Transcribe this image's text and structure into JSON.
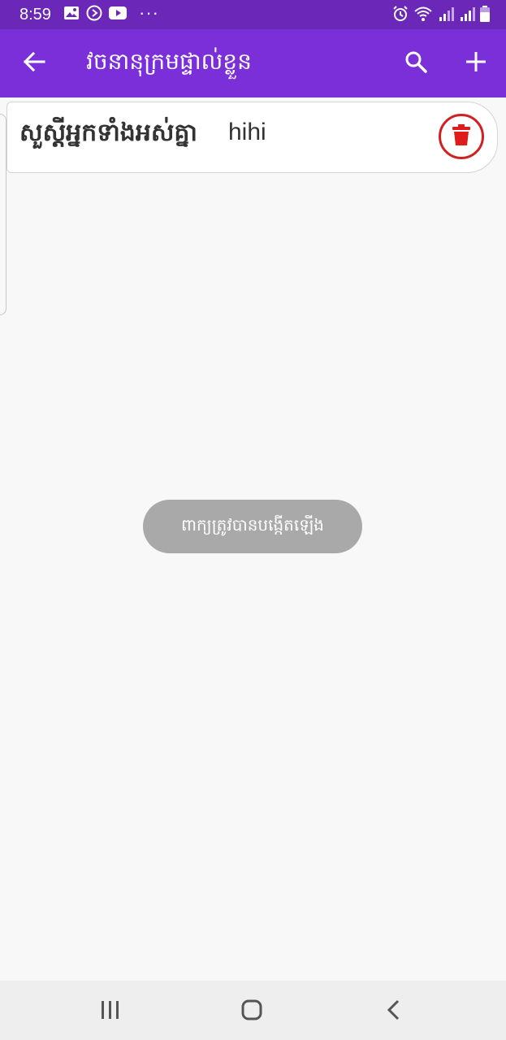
{
  "status_bar": {
    "time": "8:59",
    "dots": "···",
    "icons": [
      "gallery-icon",
      "media-icon",
      "youtube-icon",
      "alarm-icon",
      "wifi-icon",
      "signal-icon",
      "signal-icon",
      "battery-icon"
    ]
  },
  "app_bar": {
    "title": "វចនានុក្រមផ្ទាល់ខ្លួន",
    "back_icon": "back-arrow-icon",
    "search_icon": "search-icon",
    "add_icon": "add-icon"
  },
  "entries": [
    {
      "word": "សួស្ដីអ្នកទាំងអស់គ្នា",
      "meaning": "hihi",
      "delete_icon": "trash-icon"
    }
  ],
  "toast": {
    "message": "ពាក្យត្រូវបានបង្កើតឡើង"
  },
  "nav_bar": {
    "icons": [
      "recent-apps-icon",
      "home-icon",
      "back-icon"
    ]
  },
  "colors": {
    "status_bar": "#6a27b8",
    "app_bar": "#7b2fd8",
    "delete": "#d02020",
    "toast_bg": "#a9a9a9",
    "background": "#f8f8f8"
  }
}
